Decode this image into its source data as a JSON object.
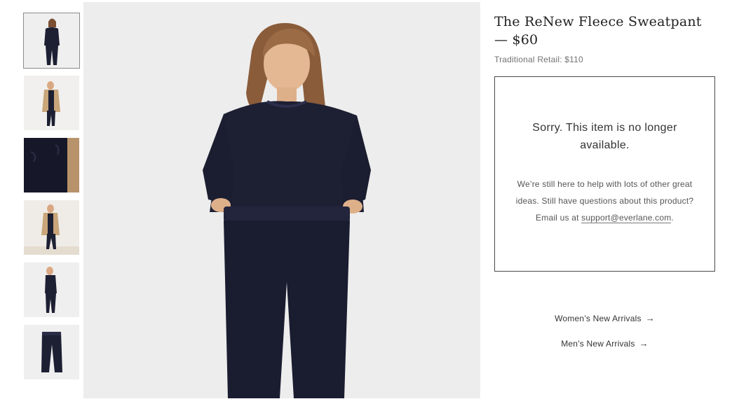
{
  "product": {
    "title": "The ReNew Fleece Sweatpant",
    "price_line": "— $60",
    "retail": "Traditional Retail: $110"
  },
  "notice": {
    "headline_1": "Sorry. This item is no longer",
    "headline_2": "available.",
    "body_1": "We’re still here to help with lots of other great",
    "body_2": "ideas. Still have questions about this product?",
    "body_3_prefix": "Email us at",
    "email": "support@everlane.com",
    "body_3_suffix": "."
  },
  "links": {
    "women": "Women’s New Arrivals",
    "men": "Men’s New Arrivals",
    "arrow": "→"
  },
  "gallery": {
    "thumbnails": [
      {
        "view": "front full-length on model",
        "selected": true
      },
      {
        "view": "model with camel coat"
      },
      {
        "view": "fabric close-up"
      },
      {
        "view": "model walking with coat"
      },
      {
        "view": "side view on model"
      },
      {
        "view": "flat lay of sweatpant"
      }
    ],
    "hero": "model wearing navy fleece crewneck and sweatpant"
  },
  "colors": {
    "navy": "#1d1f33",
    "border": "#4a4a4a",
    "background": "#ededed"
  }
}
